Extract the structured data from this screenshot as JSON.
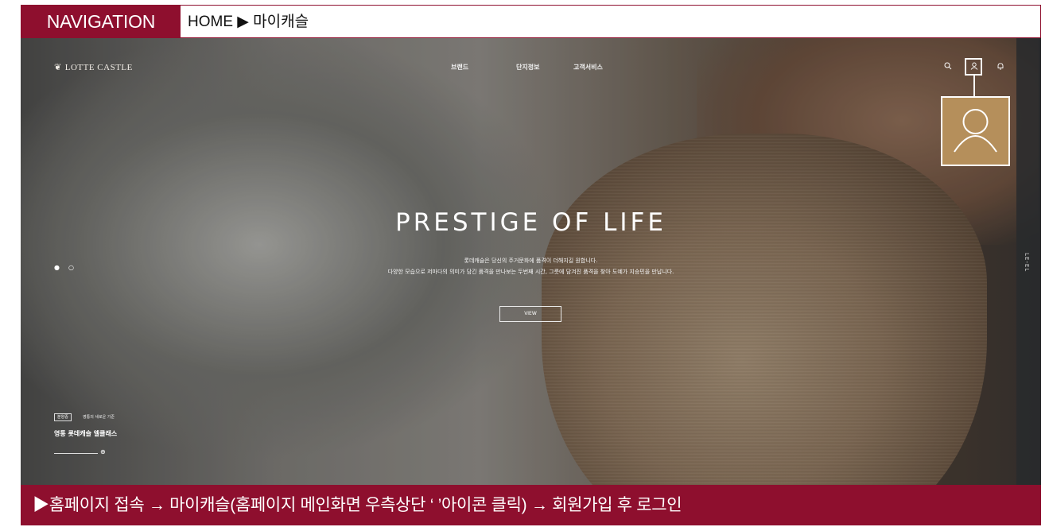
{
  "nav": {
    "tag": "NAVIGATION",
    "path": "HOME ▶ 마이캐슬"
  },
  "site": {
    "logo": "LOTTE CASTLE",
    "menu": [
      "브랜드",
      "단지정보",
      "고객서비스"
    ]
  },
  "hero": {
    "headline": "PRESTIGE OF LIFE",
    "sub_line1": "롯데캐슬은 당신의 주거문화에 품격이 더해지길 원합니다.",
    "sub_line2": "다양한 모습으로 저마다의 의미가 담긴 품격을 만나보는 두번째 시간, 그릇에 담겨진 품격을 찾아 도예가 지승민을 만납니다.",
    "view_button": "VIEW",
    "side_label": "LE-EL"
  },
  "project": {
    "tag": "분양중",
    "desc": "영통의 새로운 기준",
    "name": "영통 롯데캐슬 엘클래스"
  },
  "instruction": "▶홈페이지 접속 → 마이캐슬(홈페이지 메인화면 우측상단 ‘ ’아이콘 클릭) → 회원가입 후 로그인",
  "colors": {
    "brand": "#8e0f2e",
    "callout": "#b58f5b"
  },
  "icons": [
    "search-icon",
    "user-icon",
    "bell-icon"
  ]
}
